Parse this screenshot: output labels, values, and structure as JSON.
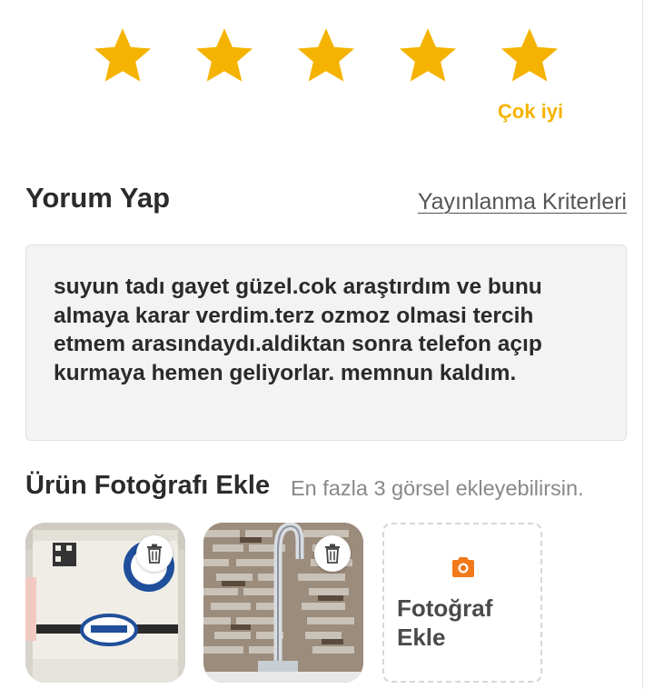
{
  "rating": {
    "value": 5,
    "max": 5,
    "label": "Çok iyi",
    "star_color": "#f5b301",
    "icon": "star-icon"
  },
  "comment": {
    "title": "Yorum Yap",
    "criteria_link": "Yayınlanma Kriterleri",
    "text": "suyun tadı gayet güzel.cok araştırdım ve bunu almaya karar verdim.terz ozmoz olmasi tercih etmem arasındaydı.aldiktan sonra telefon açıp kurmaya hemen geliyorlar. memnun kaldım."
  },
  "photos": {
    "title": "Ürün Fotoğrafı Ekle",
    "hint": "En fazla 3 görsel ekleyebilirsin.",
    "items": [
      {
        "alt": "water purifier photo",
        "delete_icon": "trash-icon"
      },
      {
        "alt": "faucet photo",
        "delete_icon": "trash-icon"
      }
    ],
    "add_label": "Fotoğraf Ekle",
    "add_icon": "camera-icon",
    "accent_color": "#f27a1a"
  }
}
